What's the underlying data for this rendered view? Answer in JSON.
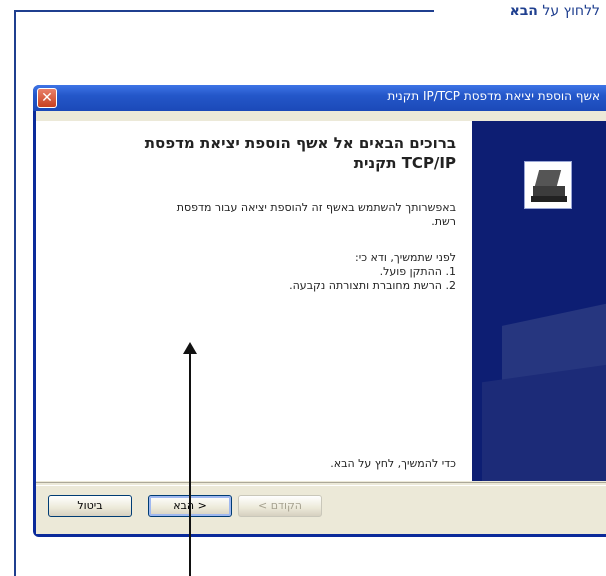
{
  "callout": {
    "prefix": "ללחוץ על",
    "bold": "הבא"
  },
  "window": {
    "title": "אשף הוספת יציאת מדפסת IP/TCP תקנית",
    "close_glyph": "✕"
  },
  "content": {
    "heading_line1": "ברוכים הבאים אל אשף הוספת יציאת מדפסת",
    "heading_line2": "TCP/IP תקנית",
    "intro": "באפשרותך להשתמש באשף זה להוספת יציאה עבור מדפסת רשת.",
    "before": "לפני שתמשיך, ודא כי:",
    "item1": "1. ההתקן פועל.",
    "item2": "2. הרשת מחוברת ותצורתה נקבעה.",
    "continue": "כדי להמשיך, לחץ על הבא."
  },
  "buttons": {
    "cancel": "ביטול",
    "next": "הבא >",
    "back": "< הקודם"
  },
  "colors": {
    "accent": "#1f3f8f",
    "side_panel": "#0d1e73",
    "titlebar": "#2457c9"
  },
  "icons": {
    "side": "printer-icon",
    "close": "close-icon",
    "pointer": "arrow-up-icon"
  }
}
